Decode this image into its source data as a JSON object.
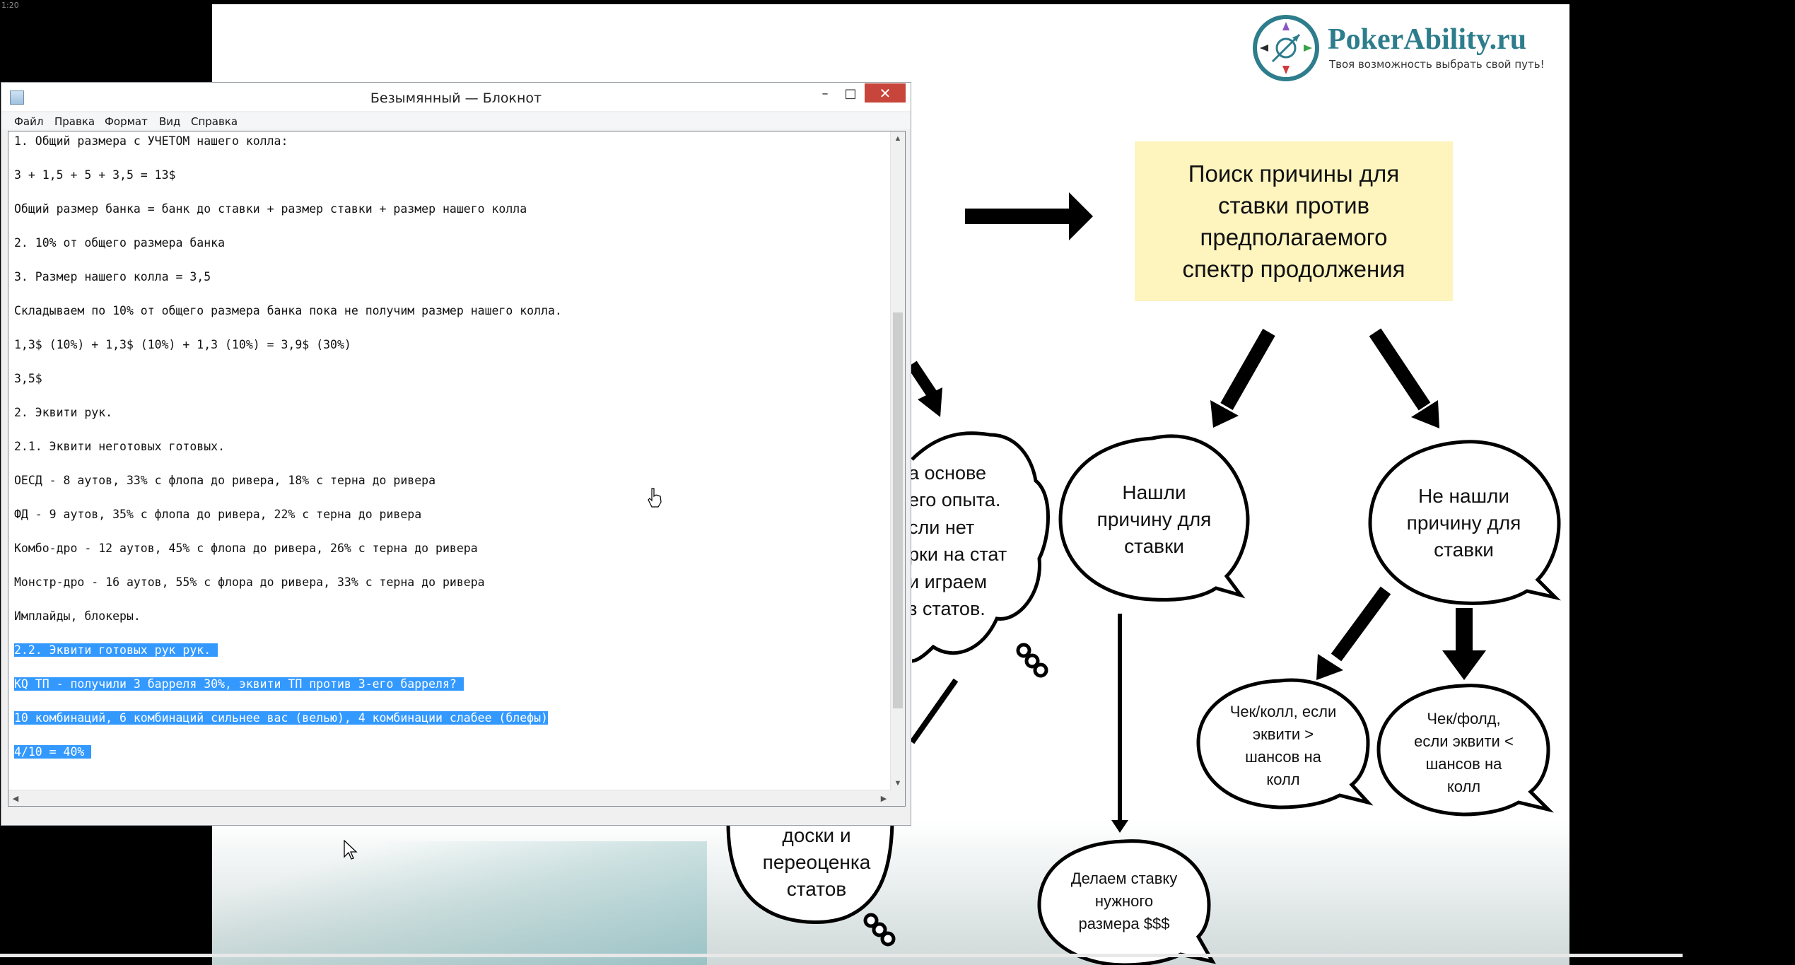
{
  "timecode": "1:20",
  "logo": {
    "name": "PokerAbility.ru",
    "tagline": "Твоя возможность выбрать свой путь!"
  },
  "slide": {
    "reason_box": "Поиск причины для\nставки против\nпредполагаемого\nспектр продолжения",
    "found_reason": "Нашли\nпричину для\nставки",
    "not_found_reason": "Не нашли\nпричину для\nставки",
    "check_call": "Чек/колл, если\nэквити >\nшансов на\nколл",
    "check_fold": "Чек/фолд,\nесли эквити <\nшансов на\nколл",
    "make_bet": "Делаем ставку\nнужного\nразмера $$$",
    "experience_partial": "а основе\nего опыта.\nсли нет\nрки на стат\nи играем\nз статов.",
    "board_partial": "доски и\nпереоценка\nстатов"
  },
  "notepad": {
    "title": "Безымянный — Блокнот",
    "minimize_glyph": "–",
    "maximize_glyph": "□",
    "close_glyph": "✕",
    "menu": [
      "Файл",
      "Правка",
      "Формат",
      "Вид",
      "Справка"
    ],
    "lines": [
      "1. Общий размера с УЧЕТОМ нашего колла:",
      "3 + 1,5 + 5 + 3,5 = 13$",
      "Общий размер банка = банк до ставки + размер ставки + размер нашего колла",
      "2. 10% от общего размера банка",
      "3. Размер нашего колла = 3,5",
      "Складываем по 10% от общего размера банка пока не получим размер нашего колла.",
      "1,3$ (10%) + 1,3$ (10%) + 1,3 (10%) = 3,9$ (30%)",
      "3,5$",
      "2. Эквити рук.",
      "2.1. Эквити неготовых готовых.",
      "ОЕСД - 8 аутов, 33% с флопа до ривера, 18% с терна до ривера",
      "ФД - 9 аутов, 35% с флопа до ривера, 22% с терна до ривера",
      "Комбо-дро - 12 аутов, 45% с флопа до ривера, 26% с терна до ривера",
      "Монстр-дро - 16 аутов, 55% с флора до ривера, 33% с терна до ривера",
      "Имплайды, блокеры.",
      "2.2. Эквити готовых рук рук. ",
      "KQ ТП - получили 3 барреля 30%, эквити ТП против 3-его барреля? ",
      "10 комбинаций, 6 комбинаций сильнее вас (велью), 4 комбинации слабее (блефы)",
      "4/10 = 40% "
    ],
    "selected_from_line": 15
  },
  "colors": {
    "slide_bg": "#ffffff",
    "reason_box_bg": "#fdf4be",
    "selection": "#3399ff",
    "close_button": "#c7453b",
    "logo_teal": "#2d7d8c"
  }
}
